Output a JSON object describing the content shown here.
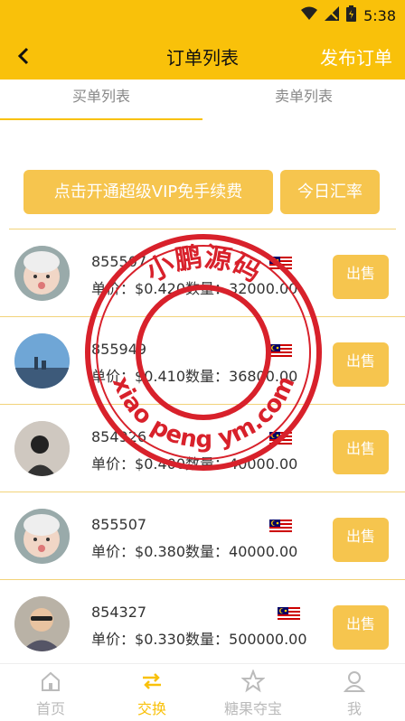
{
  "status_bar": {
    "time": "5:38"
  },
  "nav": {
    "title": "订单列表",
    "publish_label": "发布订单"
  },
  "tabs": [
    {
      "label": "买单列表"
    },
    {
      "label": "卖单列表"
    }
  ],
  "actions": {
    "vip_label": "点击开通超级VIP免手续费",
    "rate_label": "今日汇率"
  },
  "orders": [
    {
      "id": "855507",
      "price": "$0.420",
      "quantity": "32000.00",
      "action": "出售"
    },
    {
      "id": "855949",
      "price": "$0.410",
      "quantity": "36800.00",
      "action": "出售"
    },
    {
      "id": "854926",
      "price": "$0.400",
      "quantity": "40000.00",
      "action": "出售"
    },
    {
      "id": "855507",
      "price": "$0.380",
      "quantity": "40000.00",
      "action": "出售"
    },
    {
      "id": "854327",
      "price": "$0.330",
      "quantity": "500000.00",
      "action": "出售"
    }
  ],
  "row_labels": {
    "price": "单价：",
    "quantity": "数量："
  },
  "bottom_nav": [
    {
      "label": "首页",
      "icon": "home-icon"
    },
    {
      "label": "交换",
      "icon": "exchange-icon"
    },
    {
      "label": "糖果夺宝",
      "icon": "star-icon"
    },
    {
      "label": "我",
      "icon": "user-icon"
    }
  ],
  "watermark": {
    "top_text": "小鹏源码",
    "bottom_text": "xiao peng ym.com",
    "color": "#D8212B"
  },
  "colors": {
    "brand": "#F9C10A",
    "button": "#F6C54E"
  }
}
